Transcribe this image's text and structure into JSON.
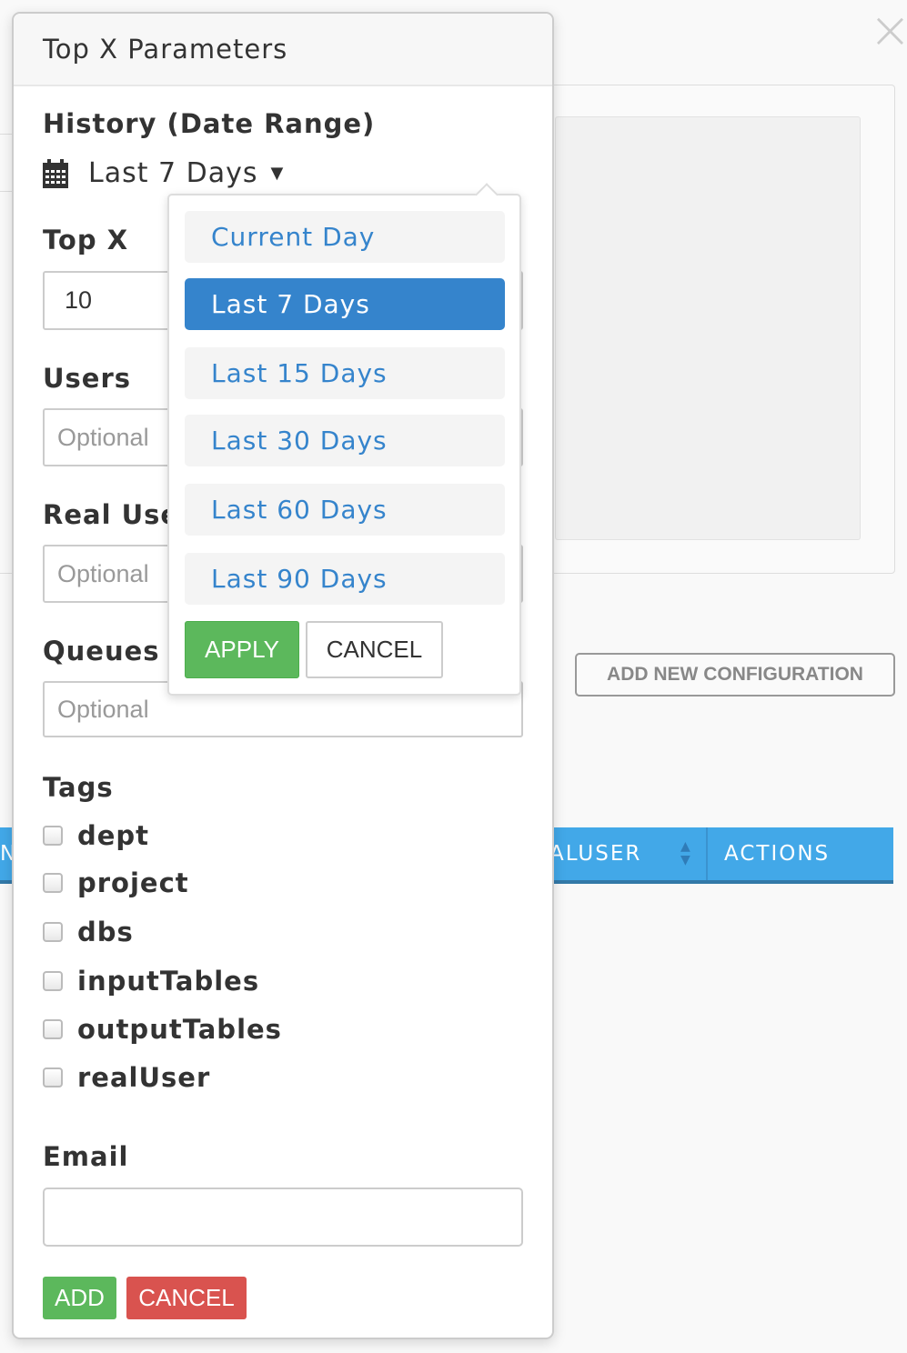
{
  "background": {
    "add_config_label": "ADD NEW CONFIGURATION",
    "table_headers": [
      "ALUSER",
      "ACTIONS"
    ],
    "partial_left": "N"
  },
  "modal": {
    "title": "Top X Parameters",
    "history_label": "History (Date Range)",
    "selected_range": "Last 7 Days",
    "topx_label": "Top X",
    "topx_value": "10",
    "users_label": "Users",
    "users_placeholder": "Optional",
    "realuser_label": "Real User",
    "realuser_placeholder": "Optional",
    "queues_label": "Queues",
    "queues_placeholder": "Optional",
    "tags_label": "Tags",
    "tags": [
      "dept",
      "project",
      "dbs",
      "inputTables",
      "outputTables",
      "realUser"
    ],
    "email_label": "Email",
    "email_value": "",
    "add_label": "ADD",
    "cancel_label": "CANCEL"
  },
  "dropdown": {
    "options": [
      "Current Day",
      "Last 7 Days",
      "Last 15 Days",
      "Last 30 Days",
      "Last 60 Days",
      "Last 90 Days"
    ],
    "selected": "Last 7 Days",
    "apply_label": "APPLY",
    "cancel_label": "CANCEL"
  },
  "colors": {
    "primary": "#3584cc",
    "success": "#5cb85c",
    "danger": "#d9534f",
    "table_header": "#42a8e8"
  }
}
